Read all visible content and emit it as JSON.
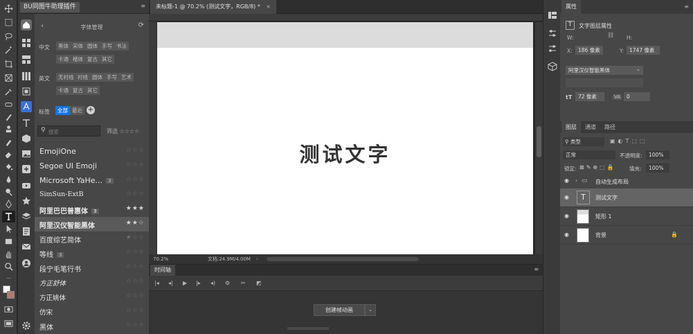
{
  "plugin": {
    "tab_title": "BU同图牛助理插件",
    "header_title": "字体管理",
    "zh_label": "中文",
    "zh_chips": [
      "黑体",
      "宋体",
      "圆体",
      "手写",
      "书法",
      "卡通",
      "楷体",
      "复古",
      "其它"
    ],
    "en_label": "英文",
    "en_chips": [
      "无衬线",
      "衬线",
      "圆体",
      "手写",
      "艺术",
      "卡通",
      "复古",
      "其它"
    ],
    "tag_label": "标签",
    "tag_all": "全部",
    "tag_recent": "最近",
    "search_placeholder": "搜索",
    "filter_label": "筛选 ☆☆☆☆",
    "fonts": [
      {
        "name": "EmojiOne",
        "badge": "",
        "stars": "☆☆☆"
      },
      {
        "name": "Segoe UI Emoji",
        "badge": "",
        "stars": "☆☆☆"
      },
      {
        "name": "Microsoft YaHe...",
        "badge": "3",
        "stars": "☆☆☆"
      },
      {
        "name": "SimSun-ExtB",
        "badge": "",
        "stars": "☆☆☆"
      },
      {
        "name": "阿里巴巴普惠体",
        "badge": "3",
        "stars": "★★★"
      },
      {
        "name": "阿里汉仪智能黑体",
        "badge": "",
        "stars": "★★☆"
      },
      {
        "name": "百度综艺简体",
        "badge": "",
        "stars": "★☆☆"
      },
      {
        "name": "等线",
        "badge": "3",
        "stars": "☆☆☆"
      },
      {
        "name": "段宁毛笔行书",
        "badge": "",
        "stars": "☆☆☆"
      },
      {
        "name": "方正舒体",
        "badge": "",
        "stars": "☆☆☆"
      },
      {
        "name": "方正姚体",
        "badge": "",
        "stars": "☆☆☆"
      },
      {
        "name": "仿宋",
        "badge": "",
        "stars": "☆☆☆"
      },
      {
        "name": "黑体",
        "badge": "",
        "stars": "☆☆☆"
      }
    ]
  },
  "document": {
    "tab_title": "未标题-1 @ 70.2% (测试文字，RGB/8) *",
    "canvas_text": "测试文字",
    "zoom": "70.2%",
    "doc_info": "文档:24.9M/4.00M"
  },
  "timeline": {
    "tab_title": "时间轴",
    "create_button": "创建帧动画"
  },
  "properties": {
    "tab_title": "属性",
    "section": "文字图层属性",
    "w_label": "W:",
    "h_label": "H:",
    "x_label": "X:",
    "x_value": "186 像素",
    "y_label": "Y:",
    "y_value": "1747 像素",
    "font_family": "阿里汉仪智能黑体",
    "font_size": "72 像素",
    "tracking": "0"
  },
  "layers": {
    "tabs": [
      "图层",
      "通道",
      "路径"
    ],
    "filter_kind": "类型",
    "blend_mode": "正常",
    "opacity_label": "不透明度:",
    "opacity_value": "100%",
    "lock_label": "锁定:",
    "fill_label": "填充:",
    "fill_value": "100%",
    "items": [
      {
        "name": "自动生成布局",
        "type": "group"
      },
      {
        "name": "测试文字",
        "type": "text"
      },
      {
        "name": "矩形 1",
        "type": "shape"
      },
      {
        "name": "背景",
        "type": "background"
      }
    ]
  },
  "colors": {
    "accent": "#1473e6",
    "panel": "#474747",
    "dark": "#282828"
  }
}
